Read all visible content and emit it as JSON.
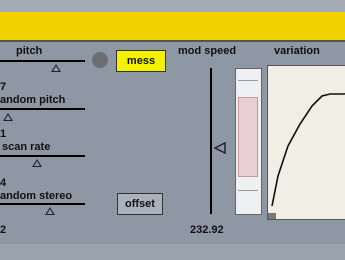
{
  "controls": {
    "pitch_label": "pitch",
    "random_pitch_value": "7",
    "random_pitch_label": "andom pitch",
    "scan_rate_value": "1",
    "scan_rate_label": "scan rate",
    "random_stereo_value": "4",
    "random_stereo_label": "andom stereo",
    "bottom_value": "2"
  },
  "buttons": {
    "mess_label": "mess",
    "offset_label": "offset"
  },
  "mod_speed": {
    "label": "mod speed",
    "value": "232.92"
  },
  "variation": {
    "label": "variation"
  },
  "colors": {
    "header_yellow": "#f1d200",
    "mess_button": "#f3f000",
    "slider_range": "#e8cfd3"
  }
}
